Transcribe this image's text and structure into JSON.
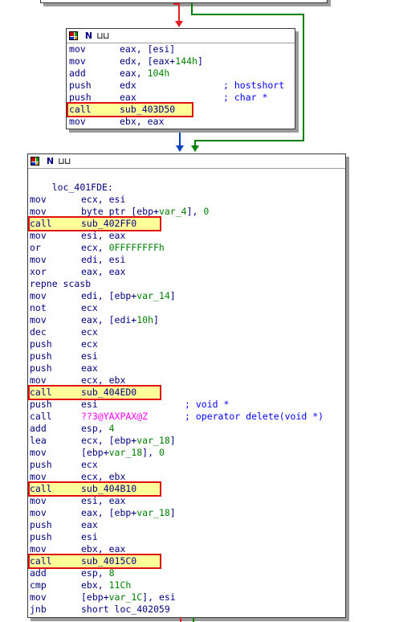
{
  "colors": {
    "mnemonic": "#000080",
    "number": "#008000",
    "comment": "#0000ff",
    "import_name": "#ff00ff",
    "highlight_fill": "#ffff9a",
    "highlight_border": "#e01010",
    "edge_red": "#e02020",
    "edge_green": "#008000",
    "edge_blue": "#0040c0"
  },
  "icons": {
    "block_header": [
      "graph-grid-icon",
      "node-n-icon",
      "bars-icon"
    ]
  },
  "block1": {
    "lines": [
      {
        "op": "mov",
        "a": "eax, [esi]"
      },
      {
        "op": "mov",
        "a": "edx, [eax+",
        "n": "144h",
        "b": "]"
      },
      {
        "op": "add",
        "a": "eax, ",
        "n": "104h"
      },
      {
        "op": "push",
        "a": "edx",
        "c": "; hostshort"
      },
      {
        "op": "push",
        "a": "eax",
        "c": "; char *"
      },
      {
        "op": "call",
        "a": "sub_403D50"
      },
      {
        "op": "mov",
        "a": "ebx, eax"
      }
    ]
  },
  "block2": {
    "label": "loc_401FDE:",
    "lines": [
      {
        "op": "mov",
        "a": "ecx, esi"
      },
      {
        "op": "mov",
        "a": "byte ptr [ebp+",
        "v": "var_4",
        "b": "], ",
        "n": "0"
      },
      {
        "op": "call",
        "a": "sub_402FF0"
      },
      {
        "op": "mov",
        "a": "esi, eax"
      },
      {
        "op": "or",
        "a": "ecx, ",
        "n": "0FFFFFFFFh"
      },
      {
        "op": "mov",
        "a": "edi, esi"
      },
      {
        "op": "xor",
        "a": "eax, eax"
      },
      {
        "op": "repne scasb",
        "a": ""
      },
      {
        "op": "mov",
        "a": "edi, [ebp+",
        "v": "var_14",
        "b": "]"
      },
      {
        "op": "not",
        "a": "ecx"
      },
      {
        "op": "mov",
        "a": "eax, [edi+",
        "n": "10h",
        "b": "]"
      },
      {
        "op": "dec",
        "a": "ecx"
      },
      {
        "op": "push",
        "a": "ecx"
      },
      {
        "op": "push",
        "a": "esi"
      },
      {
        "op": "push",
        "a": "eax"
      },
      {
        "op": "mov",
        "a": "ecx, ebx"
      },
      {
        "op": "call",
        "a": "sub_404ED0"
      },
      {
        "op": "push",
        "a": "esi",
        "c": "; void *"
      },
      {
        "op": "call",
        "imp": "??3@YAXPAX@Z",
        "c": "; operator delete(void *)"
      },
      {
        "op": "add",
        "a": "esp, ",
        "n": "4"
      },
      {
        "op": "lea",
        "a": "ecx, [ebp+",
        "v": "var_18",
        "b": "]"
      },
      {
        "op": "mov",
        "a": "[ebp+",
        "v": "var_18",
        "b": "], ",
        "n": "0"
      },
      {
        "op": "push",
        "a": "ecx"
      },
      {
        "op": "mov",
        "a": "ecx, ebx"
      },
      {
        "op": "call",
        "a": "sub_404B10"
      },
      {
        "op": "mov",
        "a": "esi, eax"
      },
      {
        "op": "mov",
        "a": "eax, [ebp+",
        "v": "var_18",
        "b": "]"
      },
      {
        "op": "push",
        "a": "eax"
      },
      {
        "op": "push",
        "a": "esi"
      },
      {
        "op": "mov",
        "a": "ebx, eax"
      },
      {
        "op": "call",
        "a": "sub_4015C0"
      },
      {
        "op": "add",
        "a": "esp, ",
        "n": "8"
      },
      {
        "op": "cmp",
        "a": "ebx, ",
        "n": "11Ch"
      },
      {
        "op": "mov",
        "a": "[ebp+",
        "v": "var_1C",
        "b": "], esi"
      },
      {
        "op": "jnb",
        "a": "short loc_402059"
      }
    ]
  }
}
